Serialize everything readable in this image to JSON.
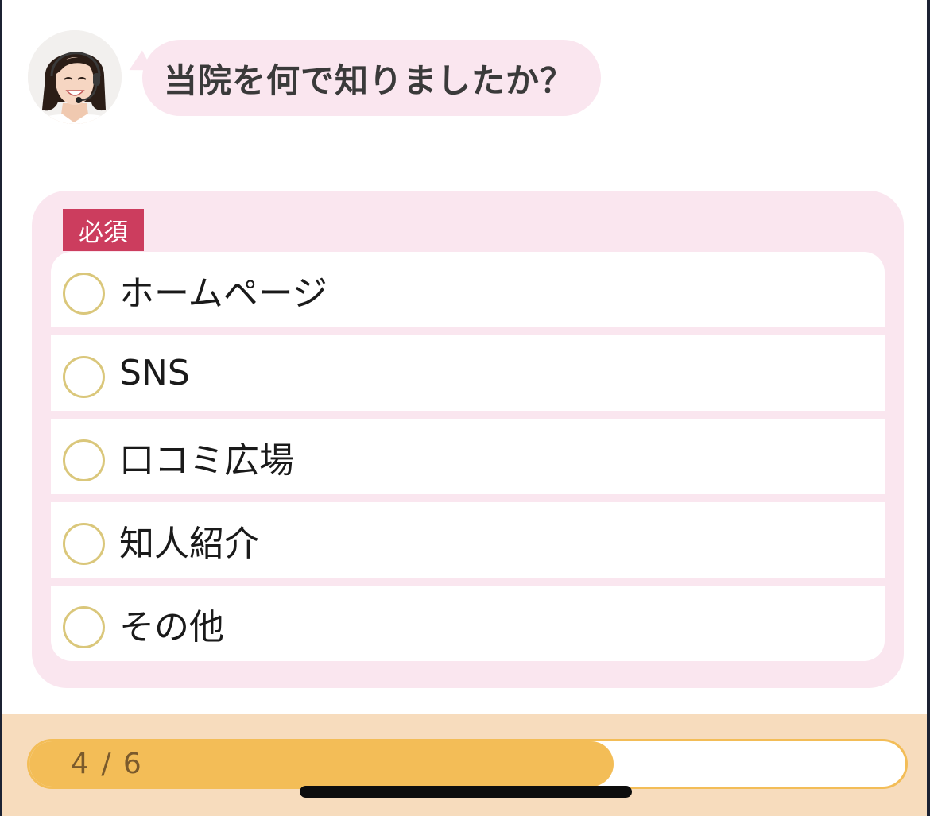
{
  "chat": {
    "avatar_icon": "operator-avatar-icon",
    "question": "当院を何で知りましたか？"
  },
  "question_card": {
    "required_label": "必須",
    "radio_icon": "radio-unselected-icon",
    "options": [
      {
        "label": "ホームページ",
        "selected": false
      },
      {
        "label": "SNS",
        "selected": false
      },
      {
        "label": "口コミ広場",
        "selected": false
      },
      {
        "label": "知人紹介",
        "selected": false
      },
      {
        "label": "その他",
        "selected": false
      }
    ]
  },
  "progress": {
    "current": 4,
    "total": 6,
    "label": "4 / 6",
    "fill_fraction": 0.667
  },
  "colors": {
    "bubble_bg": "#fae6ef",
    "card_bg": "#fae6ef",
    "required_badge": "#cc3d5e",
    "radio_border": "#dac77b",
    "progress_fill": "#f3bd57",
    "footer_bg": "#f7dcbd"
  }
}
